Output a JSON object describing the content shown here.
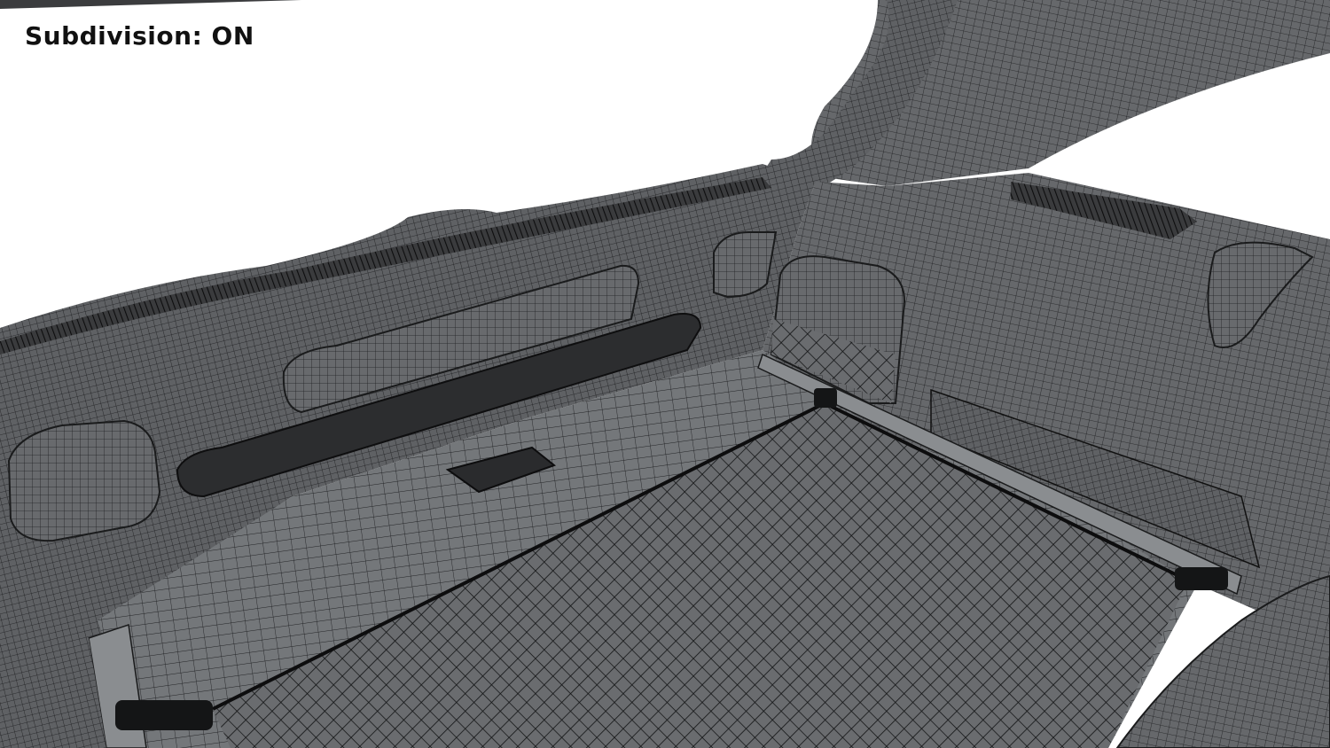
{
  "overlay": {
    "label": "Subdivision: ON"
  },
  "colors": {
    "background": "#ffffff",
    "mesh_fill": "#5c5e61",
    "mesh_light": "#8a8d90",
    "wire": "#1a1b1c",
    "shadow": "#2a2b2d"
  }
}
